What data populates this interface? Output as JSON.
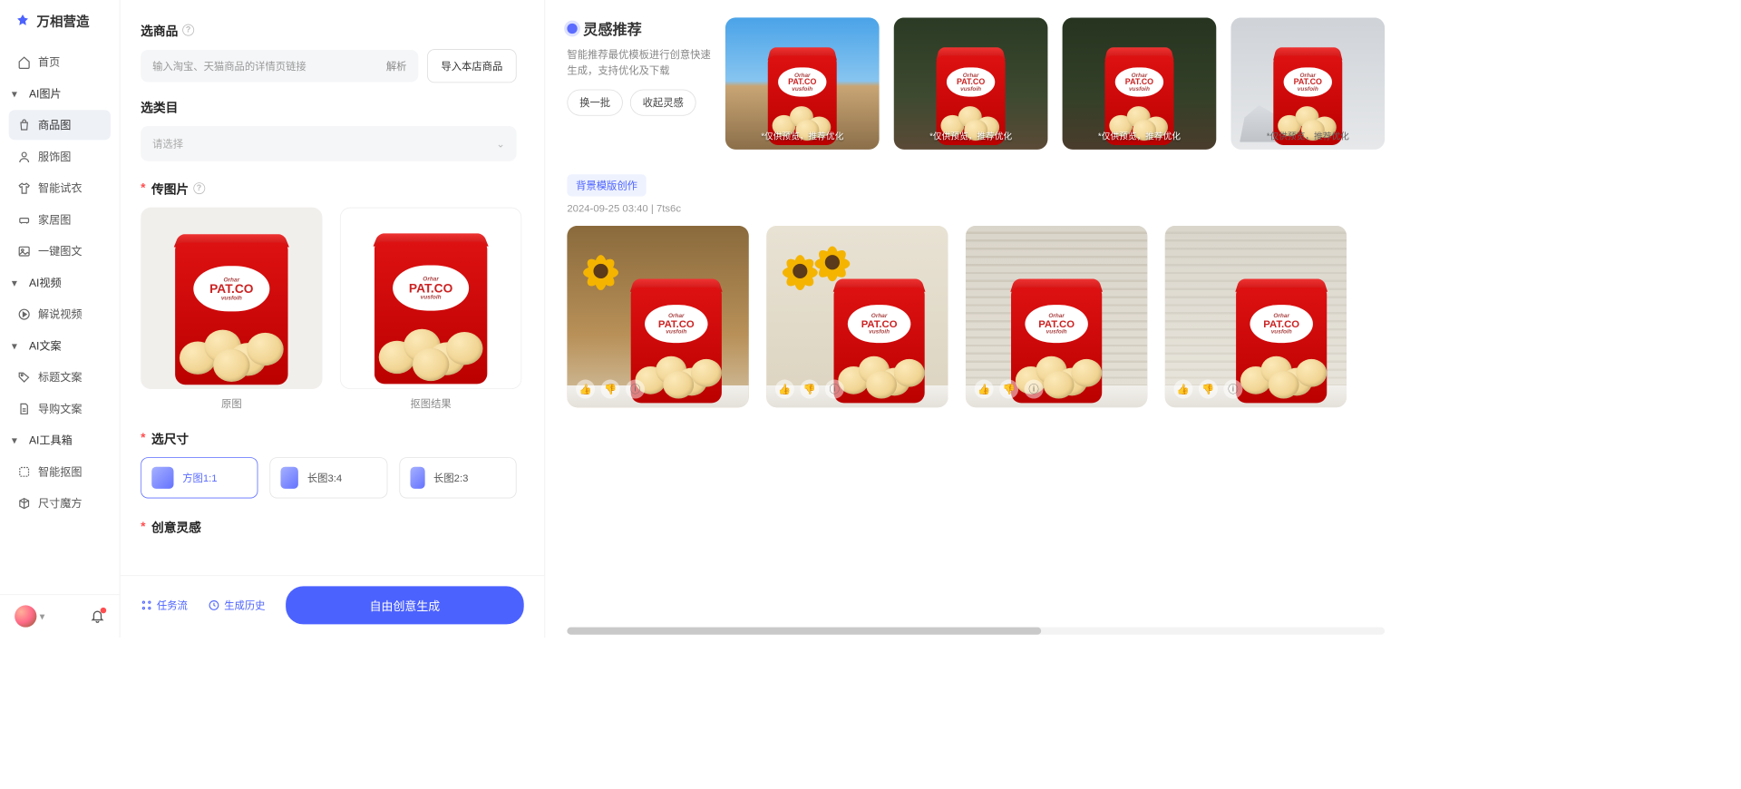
{
  "brand": "万相营造",
  "nav": {
    "home": "首页",
    "g_image": "AI图片",
    "product_img": "商品图",
    "apparel_img": "服饰图",
    "smart_tryon": "智能试衣",
    "home_img": "家居图",
    "one_click": "一键图文",
    "g_video": "AI视频",
    "explain_video": "解说视频",
    "g_copy": "AI文案",
    "title_copy": "标题文案",
    "guide_copy": "导购文案",
    "g_tools": "AI工具箱",
    "smart_cutout": "智能抠图",
    "size_magic": "尺寸魔方"
  },
  "config": {
    "select_product": "选商品",
    "product_placeholder": "输入淘宝、天猫商品的详情页链接",
    "parse": "解析",
    "import_store": "导入本店商品",
    "select_category": "选类目",
    "category_placeholder": "请选择",
    "upload_image": "传图片",
    "original": "原图",
    "cutout": "抠图结果",
    "bag_brand": "PAT.CO",
    "bag_sub_top": "Orhar",
    "bag_sub": "vusfoih",
    "select_size": "选尺寸",
    "size_sq": "方图1:1",
    "size_34": "长图3:4",
    "size_23": "长图2:3",
    "creative_title": "创意灵感",
    "task_flow": "任务流",
    "history": "生成历史",
    "generate": "自由创意生成"
  },
  "results": {
    "inspire_title": "灵感推荐",
    "inspire_desc": "智能推荐最优模板进行创意快速生成，支持优化及下载",
    "refresh": "换一批",
    "collect": "收起灵感",
    "preview_note": "*仅供预览，推荐优化",
    "batch_label": "背景模版创作",
    "batch_time": "2024-09-25 03:40",
    "batch_id": "7ts6c"
  }
}
